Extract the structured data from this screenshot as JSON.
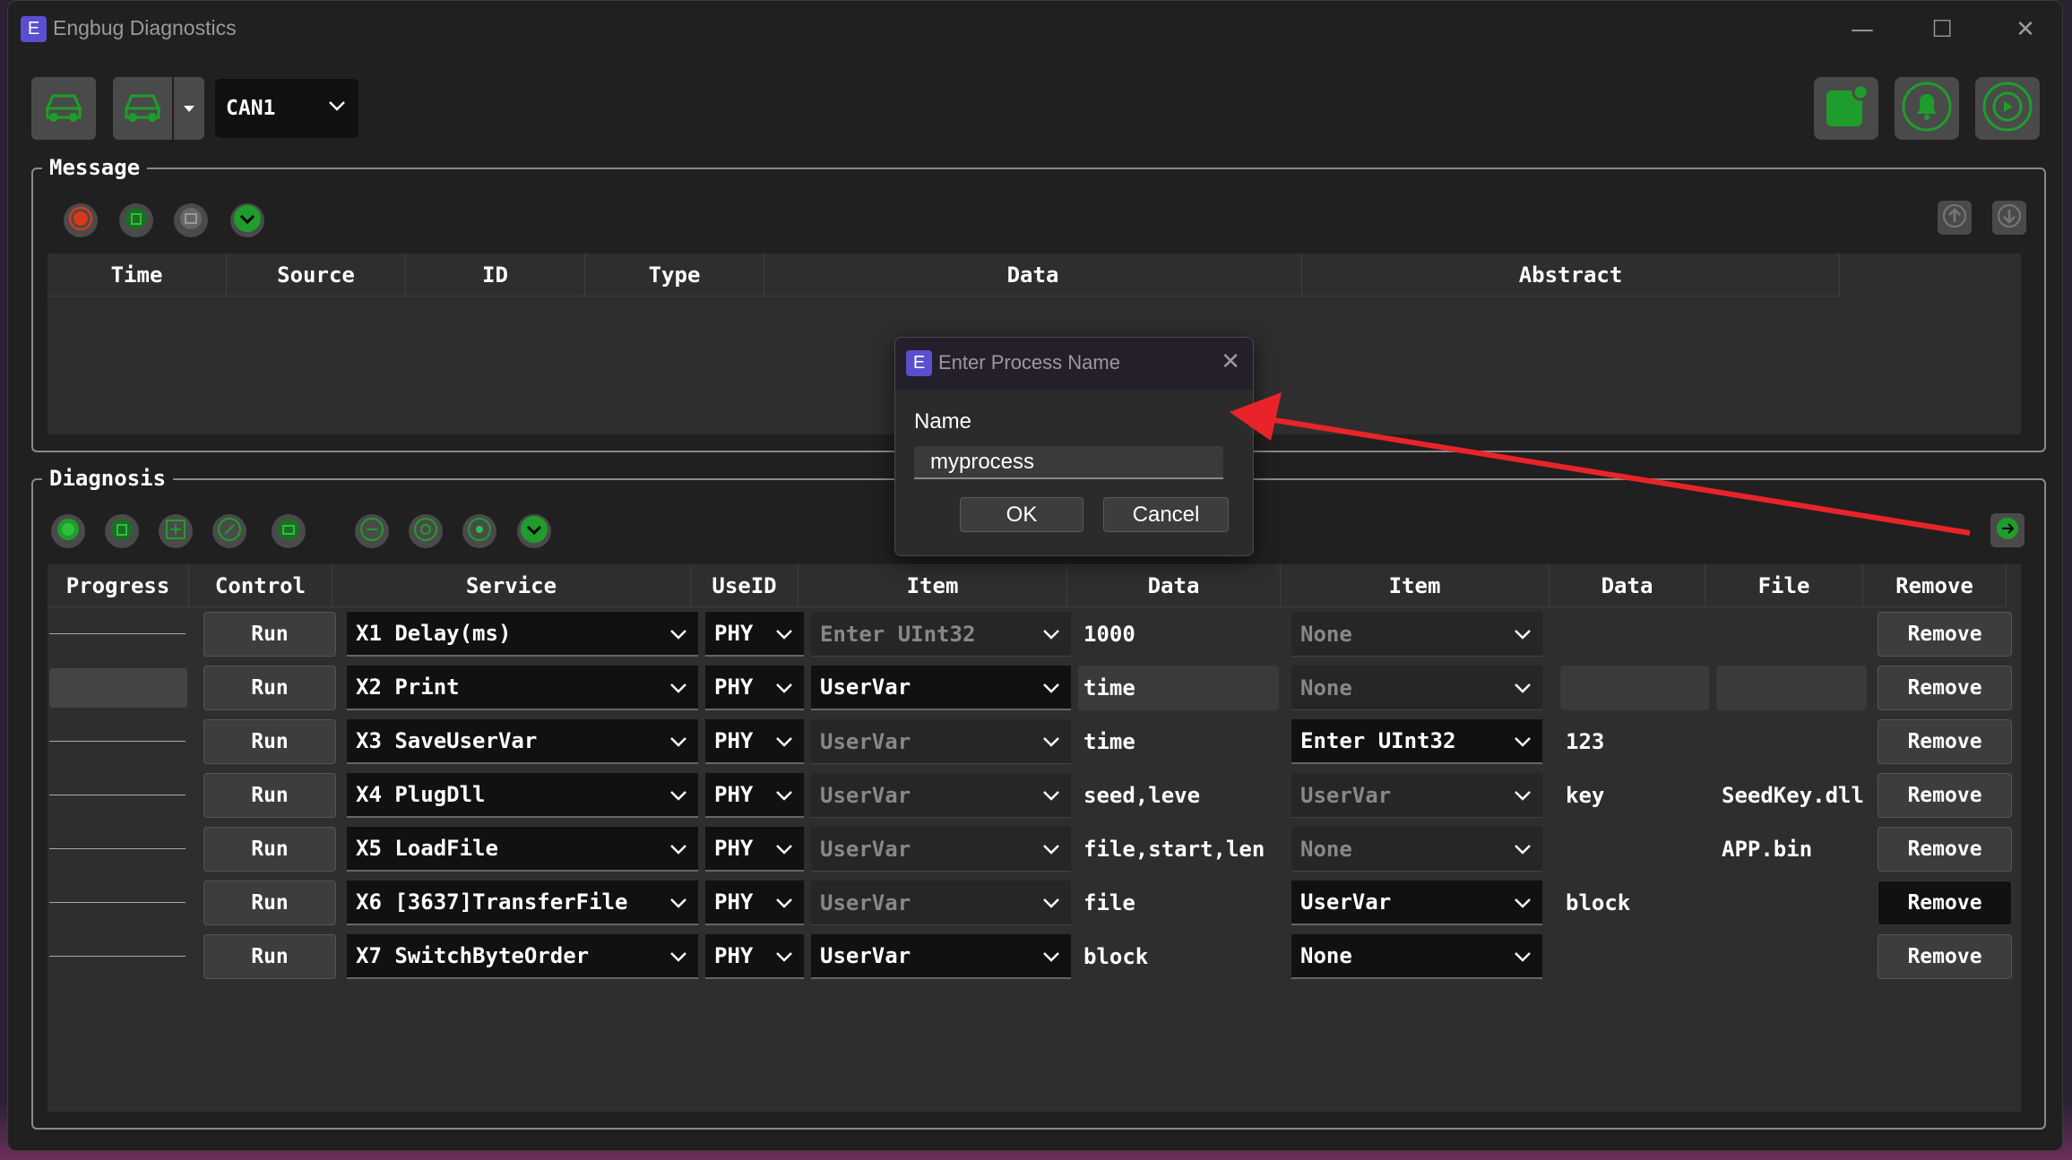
{
  "window": {
    "icon_letter": "E",
    "title": "Engbug Diagnostics",
    "minimize_glyph": "—",
    "maximize_glyph": "☐",
    "close_glyph": "✕"
  },
  "toolbar": {
    "channel_value": "CAN1",
    "icons": [
      "car-connect-icon",
      "car-icon",
      "split-dropdown-icon",
      "notepad-icon",
      "bell-icon",
      "power-icon"
    ]
  },
  "message": {
    "label": "Message",
    "columns": [
      "Time",
      "Source",
      "ID",
      "Type",
      "Data",
      "Abstract"
    ]
  },
  "diagnosis": {
    "label": "Diagnosis",
    "columns": [
      "Progress",
      "Control",
      "Service",
      "UseID",
      "Item",
      "Data",
      "Item",
      "Data",
      "File",
      "Remove"
    ],
    "rows": [
      {
        "control": "Run",
        "service": "X1 Delay(ms)",
        "useid": "PHY",
        "item1": "Enter UInt32",
        "data1": "1000",
        "item2": "None",
        "data2": "",
        "file": "",
        "remove": "Remove"
      },
      {
        "control": "Run",
        "service": "X2 Print",
        "useid": "PHY",
        "item1": "UserVar",
        "data1": "time",
        "item2": "None",
        "data2": "",
        "file": "",
        "remove": "Remove"
      },
      {
        "control": "Run",
        "service": "X3 SaveUserVar",
        "useid": "PHY",
        "item1": "UserVar",
        "data1": "time",
        "item2": "Enter UInt32",
        "data2": "123",
        "file": "",
        "remove": "Remove"
      },
      {
        "control": "Run",
        "service": "X4 PlugDll",
        "useid": "PHY",
        "item1": "UserVar",
        "data1": "seed,leve",
        "item2": "UserVar",
        "data2": "key",
        "file": "SeedKey.dll",
        "remove": "Remove"
      },
      {
        "control": "Run",
        "service": "X5 LoadFile",
        "useid": "PHY",
        "item1": "UserVar",
        "data1": "file,start,len",
        "item2": "None",
        "data2": "",
        "file": "APP.bin",
        "remove": "Remove"
      },
      {
        "control": "Run",
        "service": "X6 [3637]TransferFile",
        "useid": "PHY",
        "item1": "UserVar",
        "data1": "file",
        "item2": "UserVar",
        "data2": "block",
        "file": "",
        "remove": "Remove"
      },
      {
        "control": "Run",
        "service": "X7 SwitchByteOrder",
        "useid": "PHY",
        "item1": "UserVar",
        "data1": "block",
        "item2": "None",
        "data2": "",
        "file": "",
        "remove": "Remove"
      }
    ]
  },
  "dialog": {
    "icon_letter": "E",
    "title": "Enter Process Name",
    "close_glyph": "✕",
    "field_label": "Name",
    "field_value": "myprocess",
    "ok_label": "OK",
    "cancel_label": "Cancel"
  },
  "colors": {
    "accent_green": "#1f9d2c",
    "record_red": "#d63a1a",
    "annotation_arrow": "#e8242a"
  }
}
